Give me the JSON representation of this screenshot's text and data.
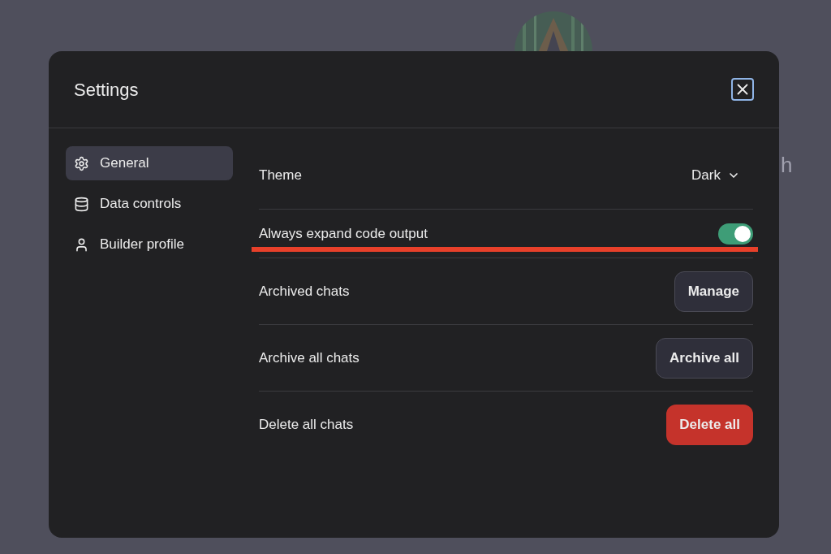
{
  "background": {
    "text": "h"
  },
  "dialog": {
    "title": "Settings"
  },
  "sidebar": {
    "items": [
      {
        "label": "General",
        "selected": true
      },
      {
        "label": "Data controls",
        "selected": false
      },
      {
        "label": "Builder profile",
        "selected": false
      }
    ]
  },
  "settings": [
    {
      "kind": "dropdown",
      "label": "Theme",
      "value": "Dark",
      "highlighted": false
    },
    {
      "kind": "toggle",
      "label": "Always expand code output",
      "on": true,
      "highlighted": true
    },
    {
      "kind": "button",
      "label": "Archived chats",
      "button": "Manage",
      "danger": false,
      "highlighted": false
    },
    {
      "kind": "button",
      "label": "Archive all chats",
      "button": "Archive all",
      "danger": false,
      "highlighted": false
    },
    {
      "kind": "button",
      "label": "Delete all chats",
      "button": "Delete all",
      "danger": true,
      "highlighted": false
    }
  ]
}
